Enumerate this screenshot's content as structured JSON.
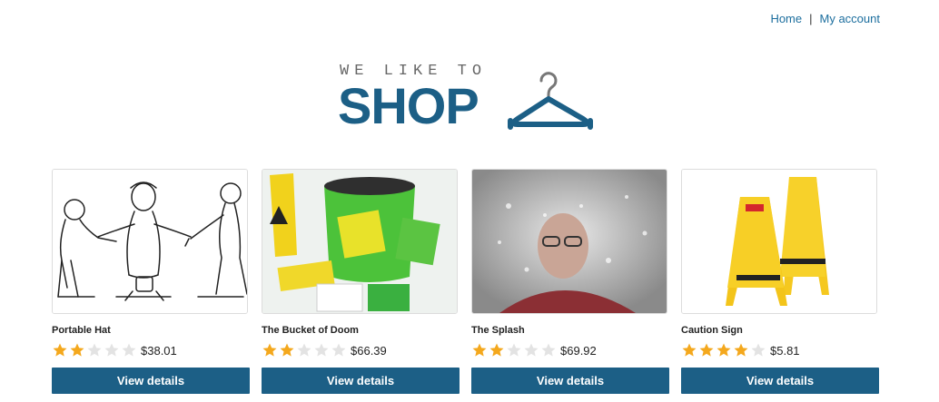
{
  "nav": {
    "home": "Home",
    "separator": "|",
    "account": "My account"
  },
  "logo": {
    "tagline": "WE LIKE TO",
    "word": "SHOP"
  },
  "products": [
    {
      "name": "Portable Hat",
      "rating": 2,
      "price": "$38.01",
      "button": "View details"
    },
    {
      "name": "The Bucket of Doom",
      "rating": 2,
      "price": "$66.39",
      "button": "View details"
    },
    {
      "name": "The Splash",
      "rating": 2,
      "price": "$69.92",
      "button": "View details"
    },
    {
      "name": "Caution Sign",
      "rating": 4,
      "price": "$5.81",
      "button": "View details"
    }
  ],
  "colors": {
    "brand": "#1c5f86",
    "star_on": "#f4a81d",
    "star_off": "#e3e3e3"
  }
}
